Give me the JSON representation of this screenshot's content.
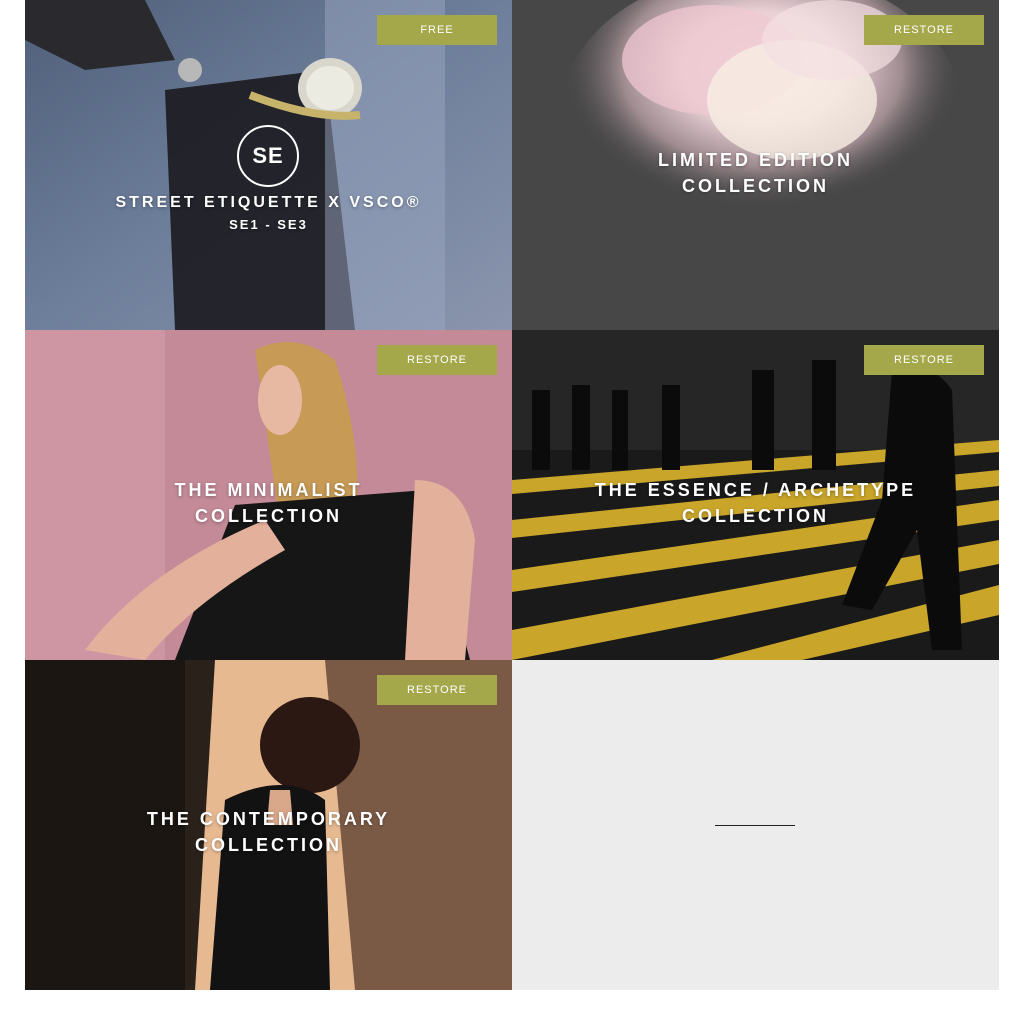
{
  "tiles": [
    {
      "button": "FREE",
      "logo": "SE",
      "title_lines": [
        "STREET ETIQUETTE X VSCO®"
      ],
      "subtitle": "SE1 - SE3"
    },
    {
      "button": "RESTORE",
      "title_lines": [
        "LIMITED EDITION",
        "COLLECTION"
      ]
    },
    {
      "button": "RESTORE",
      "title_lines": [
        "THE MINIMALIST",
        "COLLECTION"
      ]
    },
    {
      "button": "RESTORE",
      "title_lines": [
        "THE ESSENCE / ARCHETYPE",
        "COLLECTION"
      ]
    },
    {
      "button": "RESTORE",
      "title_lines": [
        "THE CONTEMPORARY",
        "COLLECTION"
      ]
    }
  ],
  "colors": {
    "button": "#a4a74a",
    "placeholder_tile": "#ececec"
  }
}
